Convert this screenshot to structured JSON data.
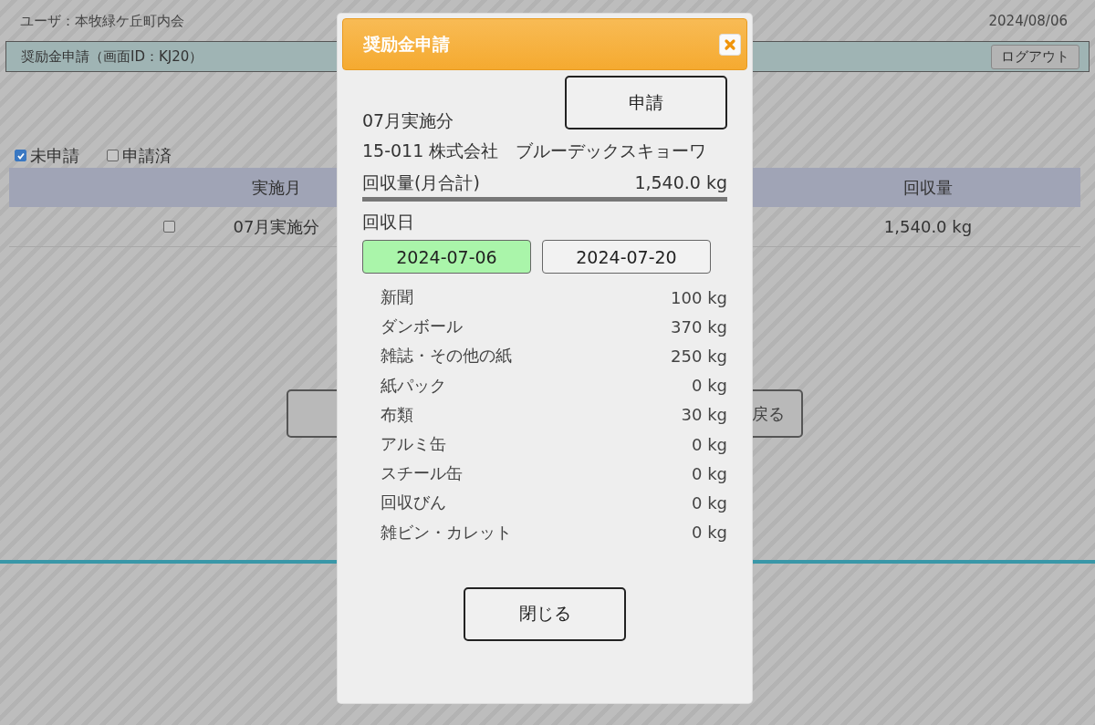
{
  "header": {
    "user": "ユーザ：本牧緑ケ丘町内会",
    "date": "2024/08/06"
  },
  "title_bar": {
    "title": "奨励金申請（画面ID：KJ20）",
    "logout_button": "ログアウト"
  },
  "filters": [
    {
      "label": "未申請",
      "checked": true
    },
    {
      "label": "申請済",
      "checked": false
    }
  ],
  "table": {
    "columns": [
      "実施月",
      "回収量"
    ],
    "rows": [
      {
        "checked": false,
        "month": "07月実施分",
        "amount": "1,540.0 kg"
      }
    ]
  },
  "back_button": "戻る",
  "dialog": {
    "title": "奨励金申請",
    "apply_button": "申請",
    "period": "07月実施分",
    "company": "15-011 株式会社　ブルーデックスキョーワ",
    "total_label": "回収量(月合計)",
    "total_value": "1,540.0 kg",
    "date_label": "回収日",
    "dates": [
      {
        "label": "2024-07-06",
        "selected": true
      },
      {
        "label": "2024-07-20",
        "selected": false
      }
    ],
    "items": [
      {
        "name": "新聞",
        "amount": "100 kg"
      },
      {
        "name": "ダンボール",
        "amount": "370 kg"
      },
      {
        "name": "雑誌・その他の紙",
        "amount": "250 kg"
      },
      {
        "name": "紙パック",
        "amount": "0 kg"
      },
      {
        "name": "布類",
        "amount": "30 kg"
      },
      {
        "name": "アルミ缶",
        "amount": "0 kg"
      },
      {
        "name": "スチール缶",
        "amount": "0 kg"
      },
      {
        "name": "回収びん",
        "amount": "0 kg"
      },
      {
        "name": "雑ビン・カレット",
        "amount": "0 kg"
      }
    ],
    "close_button": "閉じる"
  }
}
